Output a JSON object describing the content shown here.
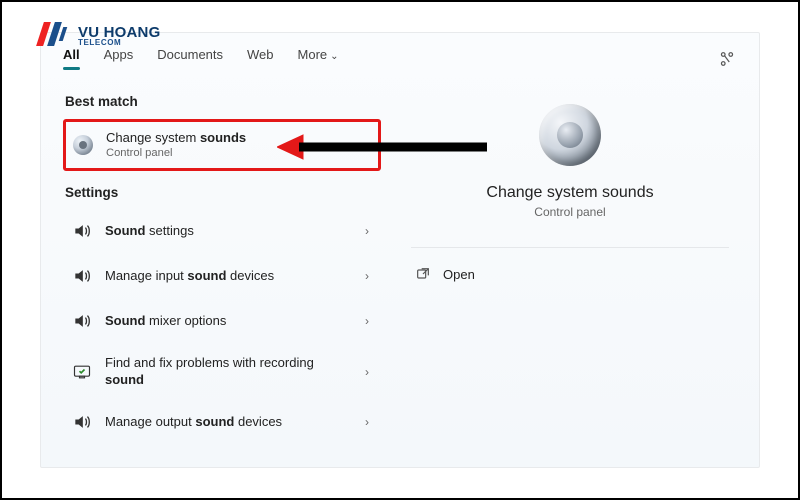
{
  "brand": {
    "name": "VU HOANG",
    "tagline": "TELECOM"
  },
  "tabs": {
    "items": [
      {
        "label": "All",
        "active": true
      },
      {
        "label": "Apps",
        "active": false
      },
      {
        "label": "Documents",
        "active": false
      },
      {
        "label": "Web",
        "active": false
      }
    ],
    "more_label": "More"
  },
  "sections": {
    "best_match": "Best match",
    "settings": "Settings"
  },
  "best_match": {
    "title_pre": "Change system ",
    "title_bold": "sounds",
    "subtitle": "Control panel"
  },
  "settings_items": [
    {
      "icon": "sound",
      "pre": "",
      "bold": "Sound",
      "post": " settings"
    },
    {
      "icon": "sound",
      "pre": "Manage input ",
      "bold": "sound",
      "post": " devices"
    },
    {
      "icon": "sound",
      "pre": "",
      "bold": "Sound",
      "post": " mixer options"
    },
    {
      "icon": "trouble",
      "pre": "Find and fix problems with recording ",
      "bold": "sound",
      "post": ""
    },
    {
      "icon": "sound",
      "pre": "Manage output ",
      "bold": "sound",
      "post": " devices"
    }
  ],
  "preview": {
    "title": "Change system sounds",
    "subtitle": "Control panel",
    "open_label": "Open"
  }
}
